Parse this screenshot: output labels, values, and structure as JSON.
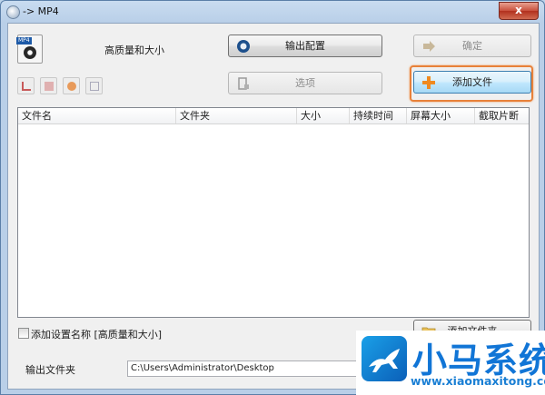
{
  "window": {
    "title": "-> MP4",
    "close_glyph": "x"
  },
  "profile": {
    "label": "高质量和大小",
    "icon": "mp4-file-icon",
    "icon_tag": "MP4"
  },
  "buttons": {
    "output_config": "输出配置",
    "ok": "确定",
    "options": "选项",
    "add_file": "添加文件",
    "add_folder": "添加文件夹"
  },
  "small_tools": [
    "remove-icon",
    "delete-icon",
    "play-icon",
    "info-icon"
  ],
  "file_list": {
    "columns": [
      "文件名",
      "文件夹",
      "大小",
      "持续时间",
      "屏幕大小",
      "截取片断"
    ],
    "rows": []
  },
  "add_setting_name": {
    "label": "添加设置名称 [高质量和大小]",
    "checked": false
  },
  "output_folder": {
    "label": "输出文件夹",
    "value": "C:\\Users\\Administrator\\Desktop"
  },
  "watermark": {
    "brand": "小马系统",
    "url": "www.xiaomaxitong.com"
  },
  "colors": {
    "accent_ring": "#e8813a",
    "brand_blue": "#1175d6"
  }
}
